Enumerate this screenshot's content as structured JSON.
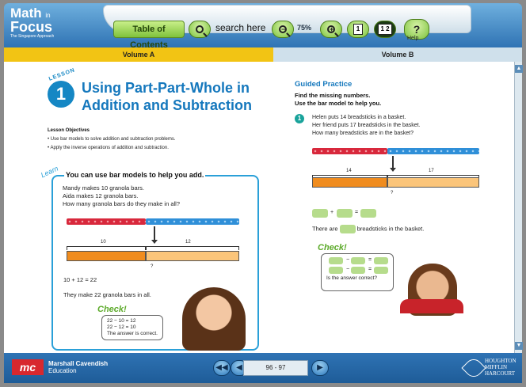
{
  "header": {
    "logo_line1": "Math",
    "logo_in": "in",
    "logo_line2": "Focus",
    "logo_tagline": "The Singapore Approach",
    "toc_label": "Table of Contents",
    "search_label": "search here",
    "zoom_level": "75%",
    "single_page_label": "1",
    "double_page_label": "1 2",
    "help_label": "Help"
  },
  "volumes": {
    "a": "Volume A",
    "b": "Volume B"
  },
  "lesson": {
    "word": "LESSON",
    "number": "1",
    "title": "Using Part-Part-Whole in Addition and Subtraction",
    "objectives_heading": "Lesson Objectives",
    "objectives": [
      "Use bar models to solve addition and subtraction problems.",
      "Apply the inverse operations of addition and subtraction."
    ]
  },
  "learn": {
    "word": "Learn",
    "title": "You can use bar models to help you add.",
    "lines": [
      "Mandy makes 10 granola bars.",
      "Aida makes 12 granola bars.",
      "How many granola bars do they make in all?"
    ],
    "part1": "10",
    "part2": "12",
    "whole": "?",
    "equation": "10 + 12 = 22",
    "answer": "They make 22 granola bars in all.",
    "check_word": "Check!",
    "check_lines": [
      "22 − 10 = 12",
      "22 − 12 = 10",
      "The answer is correct."
    ]
  },
  "guided": {
    "heading": "Guided Practice",
    "instructions": [
      "Find the missing numbers.",
      "Use the bar model to help you."
    ],
    "number": "1",
    "question": [
      "Helen puts 14 breadsticks in a basket.",
      "Her friend puts 17 breadsticks in the basket.",
      "How many breadsticks are in the basket?"
    ],
    "part1": "14",
    "part2": "17",
    "whole": "?",
    "plus": "+",
    "equals": "=",
    "minus": "−",
    "fill_before": "There are",
    "fill_after": "breadsticks in the basket.",
    "check_word": "Check!",
    "check_question": "Is the answer correct?"
  },
  "footer": {
    "publisher_line1": "Marshall Cavendish",
    "publisher_line2": "Education",
    "publisher_logo": "mc",
    "page_range": "96 - 97",
    "hmh_lines": [
      "HOUGHTON",
      "MIFFLIN",
      "HARCOURT"
    ]
  },
  "scrollbar": {
    "up": "▲",
    "down": "▼"
  },
  "nav": {
    "first": "◀◀",
    "prev": "◀",
    "next": "▶"
  }
}
